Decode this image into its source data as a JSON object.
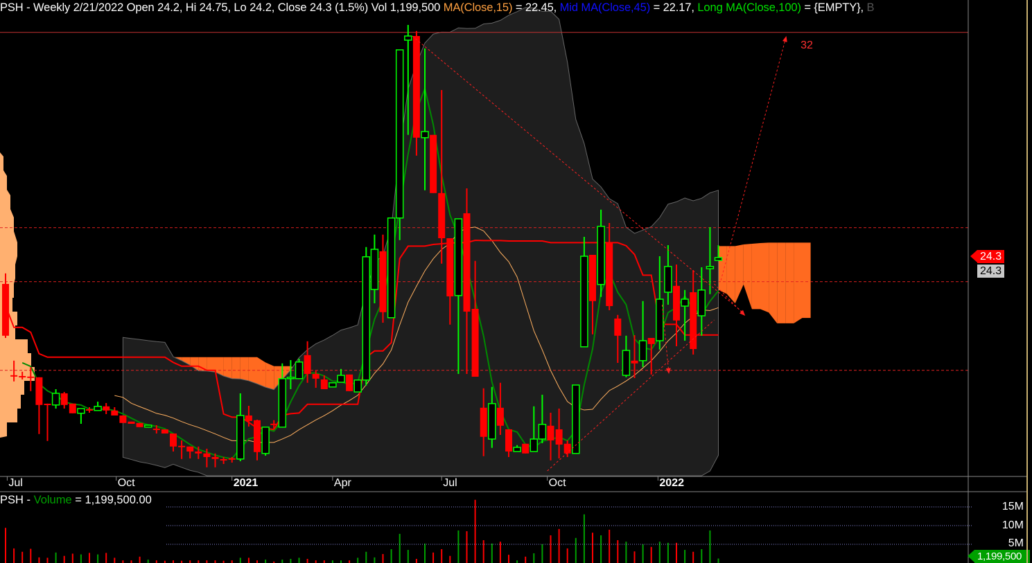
{
  "header": {
    "ticker": "PSH",
    "summary": " - Weekly 2/21/2022 Open 24.2, Hi 24.75, Lo 24.2, Close 24.3 (1.5%) Vol 1,199,500 ",
    "ma_short_label": "MA(Close,15)",
    "ma_short_value": " = 22.45, ",
    "ma_mid_label": "Mid MA(Close,45)",
    "ma_mid_value": " = 22.17, ",
    "ma_long_label": "Long MA(Close,100)",
    "ma_long_value": " = {EMPTY}, ",
    "trailing": "B"
  },
  "volume_header": {
    "ticker": "PSH",
    "sep": " - ",
    "label": "Volume",
    "value": " = 1,199,500.00"
  },
  "price_badges": {
    "last_close": "24.3",
    "last_close_gray": "24.3"
  },
  "volume_badge": "1,199,500",
  "colors": {
    "up": "#00ff00",
    "down": "#ff0000",
    "cloud_bull": "#00ff00",
    "cloud_bear": "#ff6a20",
    "band": "#1e1e1e",
    "ma_fast": "#008a00",
    "kijun": "#ff0000",
    "ma_slow": "#ffb060",
    "profile": "#ffb070"
  },
  "chart_data": [
    {
      "type": "candlestick",
      "title": "PSH - Weekly",
      "x_ticks": [
        {
          "label": "Jul",
          "index": 0.2,
          "bold": false
        },
        {
          "label": "Oct",
          "index": 13.2,
          "bold": false
        },
        {
          "label": "2021",
          "index": 27,
          "bold": true
        },
        {
          "label": "Apr",
          "index": 39,
          "bold": false
        },
        {
          "label": "Jul",
          "index": 52,
          "bold": false
        },
        {
          "label": "Oct",
          "index": 64.6,
          "bold": false
        },
        {
          "label": "2022",
          "index": 77.8,
          "bold": true
        }
      ],
      "candles_ohlc": [
        [
          23.35,
          23.73,
          21.4,
          21.48
        ],
        [
          20.03,
          20.58,
          19.83,
          20.03
        ],
        [
          20.0,
          20.18,
          19.9,
          20.0
        ],
        [
          19.98,
          20.35,
          19.48,
          19.98
        ],
        [
          19.98,
          19.98,
          17.93,
          18.98
        ],
        [
          19.0,
          19.03,
          17.68,
          19.0
        ],
        [
          18.98,
          19.55,
          18.85,
          19.4
        ],
        [
          19.4,
          19.45,
          18.85,
          18.98
        ],
        [
          19.03,
          19.03,
          18.68,
          18.68
        ],
        [
          18.68,
          18.85,
          18.3,
          18.85
        ],
        [
          18.8,
          18.9,
          18.7,
          18.8
        ],
        [
          18.78,
          19.1,
          18.78,
          18.93
        ],
        [
          18.93,
          19.05,
          18.65,
          18.78
        ],
        [
          18.78,
          18.9,
          18.6,
          18.6
        ],
        [
          18.6,
          18.6,
          18.33,
          18.33
        ],
        [
          18.38,
          18.38,
          18.3,
          18.3
        ],
        [
          18.33,
          18.33,
          18.18,
          18.18
        ],
        [
          18.18,
          18.25,
          18.18,
          18.25
        ],
        [
          18.1,
          18.25,
          17.95,
          18.1
        ],
        [
          18.1,
          18.1,
          17.95,
          17.95
        ],
        [
          17.95,
          17.95,
          17.3,
          17.48
        ],
        [
          17.48,
          17.7,
          17.03,
          17.48
        ],
        [
          17.48,
          17.48,
          17.05,
          17.3
        ],
        [
          17.3,
          17.48,
          17.03,
          17.23
        ],
        [
          17.23,
          17.4,
          16.73,
          17.1
        ],
        [
          17.1,
          17.23,
          16.73,
          17.03
        ],
        [
          17.0,
          17.1,
          16.85,
          17.0
        ],
        [
          17.03,
          17.1,
          16.9,
          17.03
        ],
        [
          17.03,
          19.4,
          16.95,
          18.6
        ],
        [
          18.6,
          18.95,
          18.2,
          18.4
        ],
        [
          18.43,
          18.45,
          16.98,
          17.28
        ],
        [
          17.23,
          18.18,
          17.15,
          18.18
        ],
        [
          18.28,
          18.43,
          18.1,
          18.28
        ],
        [
          18.18,
          20.48,
          18.18,
          19.93
        ],
        [
          19.93,
          20.6,
          19.55,
          19.98
        ],
        [
          19.93,
          20.65,
          19.93,
          20.53
        ],
        [
          20.78,
          21.28,
          19.78,
          20.1
        ],
        [
          20.1,
          20.23,
          19.6,
          19.93
        ],
        [
          19.9,
          20.05,
          19.55,
          19.55
        ],
        [
          19.63,
          19.78,
          19.63,
          19.78
        ],
        [
          19.8,
          20.28,
          19.8,
          20.05
        ],
        [
          20.08,
          20.08,
          19.48,
          19.48
        ],
        [
          19.45,
          19.88,
          19.45,
          19.88
        ],
        [
          19.88,
          24.68,
          19.68,
          24.33
        ],
        [
          23.15,
          25.13,
          22.65,
          24.6
        ],
        [
          24.53,
          25.13,
          21.95,
          22.33
        ],
        [
          22.13,
          25.73,
          22.13,
          25.73
        ],
        [
          25.73,
          31.8,
          24.93,
          31.8
        ],
        [
          32.15,
          32.7,
          28.73,
          32.3
        ],
        [
          32.3,
          32.48,
          27.98,
          28.63
        ],
        [
          28.63,
          31.85,
          26.73,
          28.85
        ],
        [
          28.73,
          28.73,
          26.63,
          26.63
        ],
        [
          26.63,
          30.35,
          24.08,
          25.0
        ],
        [
          25.0,
          25.0,
          21.88,
          22.9
        ],
        [
          22.93,
          25.7,
          20.1,
          25.7
        ],
        [
          25.9,
          26.8,
          20.1,
          22.35
        ],
        [
          22.45,
          24.18,
          20.0,
          20.0
        ],
        [
          18.88,
          19.58,
          17.13,
          17.83
        ],
        [
          17.75,
          19.63,
          17.43,
          19.03
        ],
        [
          18.88,
          19.78,
          17.9,
          18.23
        ],
        [
          18.1,
          18.1,
          17.1,
          17.3
        ],
        [
          17.3,
          17.53,
          17.3,
          17.45
        ],
        [
          17.58,
          17.58,
          17.23,
          17.23
        ],
        [
          17.3,
          18.93,
          17.3,
          17.75
        ],
        [
          17.75,
          19.35,
          17.6,
          18.28
        ],
        [
          18.23,
          18.7,
          16.98,
          17.7
        ],
        [
          18.1,
          18.85,
          17.05,
          17.55
        ],
        [
          17.58,
          17.7,
          17.1,
          17.23
        ],
        [
          17.23,
          19.7,
          17.23,
          19.7
        ],
        [
          21.08,
          25.05,
          21.08,
          24.35
        ],
        [
          24.4,
          24.4,
          21.53,
          22.73
        ],
        [
          23.33,
          26.03,
          22.88,
          25.43
        ],
        [
          24.85,
          25.55,
          22.4,
          22.55
        ],
        [
          22.1,
          22.23,
          20.5,
          21.48
        ],
        [
          20.05,
          21.48,
          19.98,
          20.95
        ],
        [
          20.58,
          21.5,
          19.95,
          20.48
        ],
        [
          20.58,
          22.73,
          20.35,
          21.3
        ],
        [
          21.4,
          21.4,
          20.08,
          21.18
        ],
        [
          21.3,
          24.35,
          20.98,
          22.8
        ],
        [
          23.05,
          24.75,
          22.6,
          23.98
        ],
        [
          23.28,
          24.05,
          21.1,
          22.03
        ],
        [
          22.55,
          23.13,
          21.3,
          22.8
        ],
        [
          23.05,
          23.85,
          20.8,
          21.0
        ],
        [
          22.2,
          23.95,
          21.48,
          23.13
        ],
        [
          23.9,
          25.4,
          22.98,
          23.98
        ],
        [
          24.2,
          24.75,
          24.2,
          24.3
        ]
      ],
      "horizontal_levels": [
        {
          "price": 32.43,
          "style": "solid"
        },
        {
          "price": 25.38,
          "style": "dashed"
        },
        {
          "price": 23.43,
          "style": "dashed"
        },
        {
          "price": 20.23,
          "style": "dashed"
        }
      ],
      "trend_lines": [
        {
          "from": [
            48.5,
            32.3
          ],
          "to": [
            88.0,
            22.3
          ],
          "arrow": false
        },
        {
          "from": [
            64.6,
            16.6
          ],
          "to": [
            84.5,
            22.05
          ],
          "arrow": false
        },
        {
          "from": [
            85.3,
            23.48
          ],
          "to": [
            93.1,
            32.3
          ],
          "arrow": true
        },
        {
          "from": [
            78.3,
            22.6
          ],
          "to": [
            79.1,
            20.1
          ],
          "arrow": true
        },
        {
          "from": [
            84.5,
            23.35
          ],
          "to": [
            88.2,
            22.2
          ],
          "arrow": true
        }
      ],
      "target_annotation": {
        "label": "32",
        "index": 94.8,
        "price": 32.0
      },
      "volume_profile": [
        [
          27.7,
          0.1
        ],
        [
          27.0,
          0.2
        ],
        [
          26.3,
          0.3
        ],
        [
          25.5,
          0.4
        ],
        [
          24.6,
          0.5
        ],
        [
          23.8,
          0.44
        ],
        [
          23.1,
          0.4
        ],
        [
          22.6,
          0.36
        ],
        [
          22.1,
          0.5
        ],
        [
          21.6,
          0.44
        ],
        [
          21.1,
          0.8
        ],
        [
          20.6,
          0.9
        ],
        [
          20.1,
          1.0
        ],
        [
          19.6,
          0.7
        ],
        [
          19.1,
          0.6
        ],
        [
          18.6,
          0.5
        ],
        [
          18.1,
          0.2
        ]
      ],
      "indicators": {
        "fast_ma": 4,
        "slow_ma": 15,
        "kijun": 26,
        "tenkan": 9,
        "span_b": 52,
        "cloud_shift": 11,
        "band_period": 20,
        "band_sd": 2
      }
    },
    {
      "type": "bar",
      "title": "Volume",
      "y_ticks": [
        "15M",
        "10M",
        "5M"
      ],
      "y_tick_values": [
        15,
        10,
        5
      ],
      "unit": "M",
      "values": [
        9.4,
        3.9,
        3.0,
        3.8,
        1.5,
        1.4,
        2.8,
        1.9,
        2.5,
        2.3,
        2.7,
        2.3,
        2.7,
        1.4,
        0.7,
        0.7,
        1.7,
        0.9,
        0.7,
        0.6,
        0.7,
        0.6,
        0.7,
        0.7,
        0.7,
        0.7,
        0.6,
        0.7,
        1.4,
        1.4,
        0.7,
        0.9,
        0.4,
        0.9,
        1.1,
        1.4,
        1.1,
        0.7,
        0.7,
        0.7,
        0.7,
        0.7,
        1.4,
        3.0,
        1.5,
        2.4,
        3.7,
        7.8,
        3.5,
        1.1,
        5.2,
        2.8,
        3.7,
        1.9,
        8.7,
        8.5,
        16.9,
        6.1,
        5.2,
        5.7,
        2.2,
        0.7,
        1.7,
        2.6,
        5.0,
        7.4,
        9.1,
        3.9,
        6.7,
        13.0,
        8.1,
        7.4,
        8.9,
        6.1,
        5.7,
        3.1,
        5.0,
        4.3,
        5.7,
        5.4,
        5.4,
        3.5,
        3.0,
        3.7,
        8.7,
        1.2
      ],
      "up_flags": [
        0,
        0,
        0,
        0,
        0,
        0,
        1,
        0,
        0,
        1,
        0,
        1,
        0,
        0,
        0,
        0,
        0,
        1,
        0,
        0,
        0,
        0,
        0,
        0,
        0,
        0,
        0,
        0,
        1,
        0,
        0,
        1,
        0,
        1,
        1,
        1,
        0,
        0,
        0,
        1,
        1,
        0,
        1,
        1,
        1,
        0,
        1,
        1,
        1,
        0,
        1,
        0,
        0,
        0,
        1,
        0,
        0,
        0,
        1,
        0,
        0,
        1,
        0,
        1,
        1,
        0,
        0,
        0,
        1,
        1,
        0,
        1,
        0,
        0,
        1,
        0,
        1,
        0,
        1,
        1,
        0,
        1,
        0,
        1,
        1,
        1
      ]
    }
  ]
}
